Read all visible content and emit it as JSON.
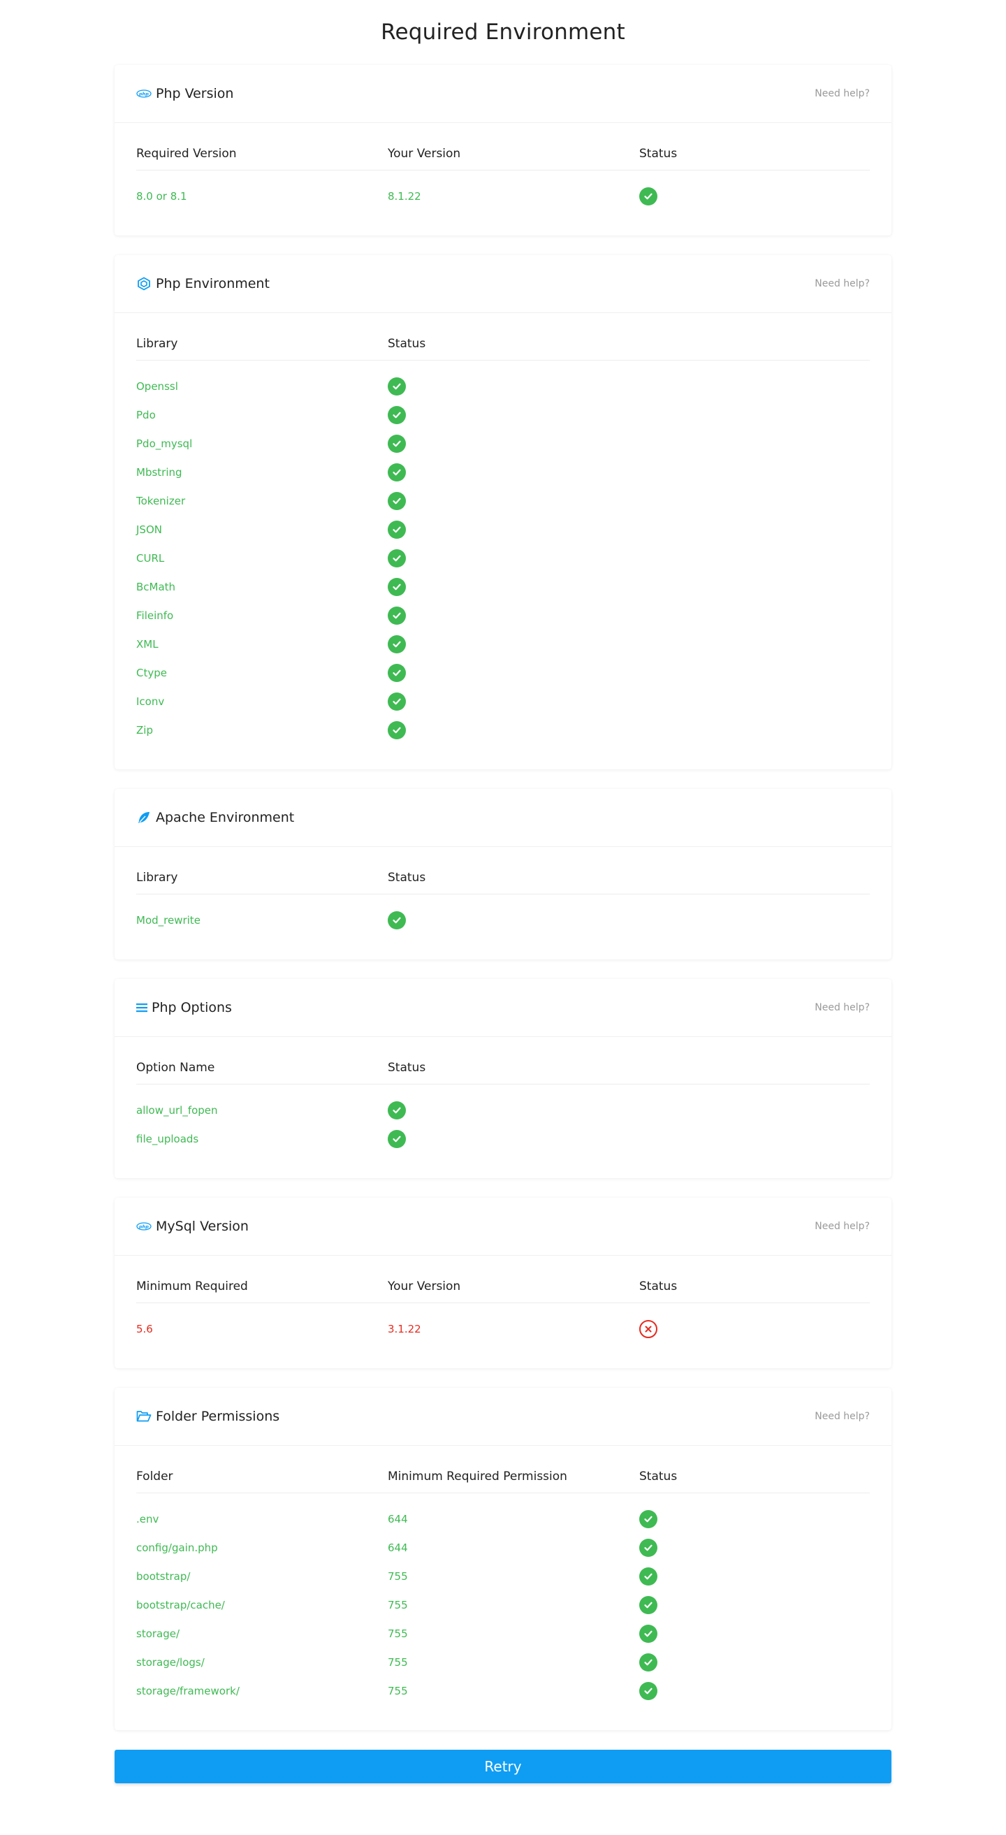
{
  "page": {
    "title": "Required Environment",
    "retry_label": "Retry"
  },
  "colors": {
    "ok": "#3fba53",
    "bad": "#e52c20",
    "accent": "#0f9df3"
  },
  "php_version": {
    "title": "Php Version",
    "icon": "php-logo-icon",
    "help": "Need help?",
    "headers": [
      "Required Version",
      "Your Version",
      "Status"
    ],
    "rows": [
      {
        "required": "8.0 or 8.1",
        "yours": "8.1.22",
        "ok": true
      }
    ]
  },
  "php_environment": {
    "title": "Php Environment",
    "icon": "cube-icon",
    "help": "Need help?",
    "headers": [
      "Library",
      "Status"
    ],
    "rows": [
      {
        "name": "Openssl",
        "ok": true
      },
      {
        "name": "Pdo",
        "ok": true
      },
      {
        "name": "Pdo_mysql",
        "ok": true
      },
      {
        "name": "Mbstring",
        "ok": true
      },
      {
        "name": "Tokenizer",
        "ok": true
      },
      {
        "name": "JSON",
        "ok": true
      },
      {
        "name": "CURL",
        "ok": true
      },
      {
        "name": "BcMath",
        "ok": true
      },
      {
        "name": "Fileinfo",
        "ok": true
      },
      {
        "name": "XML",
        "ok": true
      },
      {
        "name": "Ctype",
        "ok": true
      },
      {
        "name": "Iconv",
        "ok": true
      },
      {
        "name": "Zip",
        "ok": true
      }
    ]
  },
  "apache_environment": {
    "title": "Apache Environment",
    "icon": "feather-icon",
    "headers": [
      "Library",
      "Status"
    ],
    "rows": [
      {
        "name": "Mod_rewrite",
        "ok": true
      }
    ]
  },
  "php_options": {
    "title": "Php Options",
    "icon": "list-icon",
    "help": "Need help?",
    "headers": [
      "Option Name",
      "Status"
    ],
    "rows": [
      {
        "name": "allow_url_fopen",
        "ok": true
      },
      {
        "name": "file_uploads",
        "ok": true
      }
    ]
  },
  "mysql_version": {
    "title": "MySql Version",
    "icon": "php-logo-icon",
    "help": "Need help?",
    "headers": [
      "Minimum Required",
      "Your Version",
      "Status"
    ],
    "rows": [
      {
        "required": "5.6",
        "yours": "3.1.22",
        "ok": false
      }
    ]
  },
  "folder_permissions": {
    "title": "Folder Permissions",
    "icon": "folder-open-icon",
    "help": "Need help?",
    "headers": [
      "Folder",
      "Minimum Required Permission",
      "Status"
    ],
    "rows": [
      {
        "folder": ".env",
        "perm": "644",
        "ok": true
      },
      {
        "folder": "config/gain.php",
        "perm": "644",
        "ok": true
      },
      {
        "folder": "bootstrap/",
        "perm": "755",
        "ok": true
      },
      {
        "folder": "bootstrap/cache/",
        "perm": "755",
        "ok": true
      },
      {
        "folder": "storage/",
        "perm": "755",
        "ok": true
      },
      {
        "folder": "storage/logs/",
        "perm": "755",
        "ok": true
      },
      {
        "folder": "storage/framework/",
        "perm": "755",
        "ok": true
      }
    ]
  }
}
